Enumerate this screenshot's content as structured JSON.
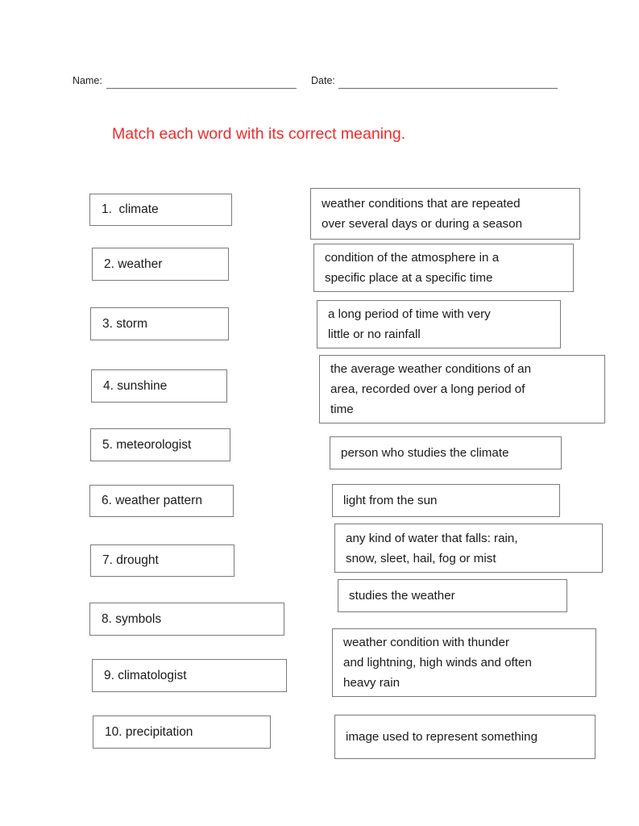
{
  "header": {
    "name_label": "Name:",
    "date_label": "Date:",
    "name_value": "",
    "date_value": ""
  },
  "instruction": {
    "text": "Match each word with its correct meaning.",
    "color": "#ee2b2b"
  },
  "words": [
    {
      "label": "1.  climate"
    },
    {
      "label": "2. weather"
    },
    {
      "label": "3. storm"
    },
    {
      "label": "4. sunshine"
    },
    {
      "label": "5. meteorologist"
    },
    {
      "label": "6. weather pattern"
    },
    {
      "label": "7. drought"
    },
    {
      "label": "8. symbols"
    },
    {
      "label": "9. climatologist"
    },
    {
      "label": "10. precipitation"
    }
  ],
  "definitions": [
    {
      "text": "weather conditions that are repeated\nover several days or during a  season"
    },
    {
      "text": "condition of the atmosphere in a\nspecific place at a specific time"
    },
    {
      "text": "a long period of time with very\nlittle or no rainfall"
    },
    {
      "text": "the average weather conditions of an\narea, recorded over a long period of\ntime"
    },
    {
      "text": "person who studies the climate"
    },
    {
      "text": "light from the sun"
    },
    {
      "text": "any kind of water that falls: rain,\nsnow, sleet, hail, fog or mist"
    },
    {
      "text": "studies the weather"
    },
    {
      "text": "weather condition with thunder\nand lightning, high winds and often\nheavy rain"
    },
    {
      "text": "image used to represent something"
    }
  ]
}
